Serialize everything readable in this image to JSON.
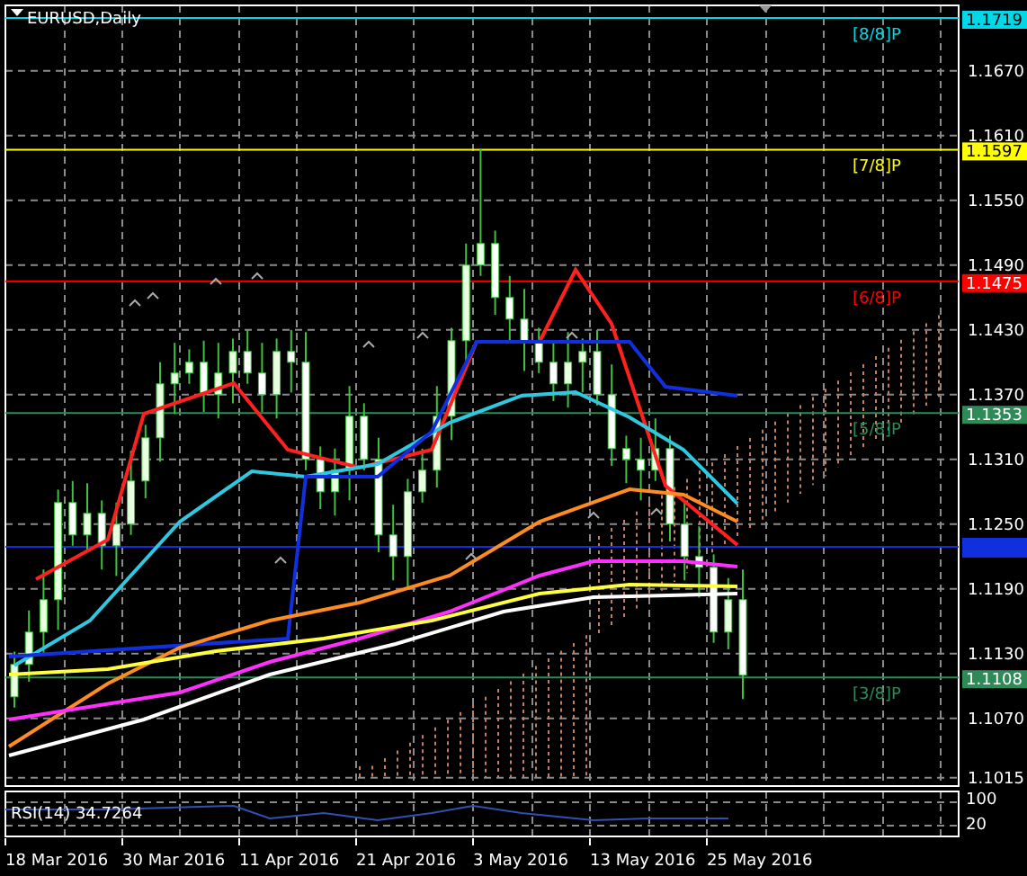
{
  "chart": {
    "title": "EURUSD,Daily",
    "price_ticks": [
      "1.1670",
      "1.1610",
      "1.1550",
      "1.1490",
      "1.1430",
      "1.1370",
      "1.1310",
      "1.1250",
      "1.1190",
      "1.1130",
      "1.1070",
      "1.1015"
    ],
    "price_lines": [
      {
        "tag": "1.1719",
        "line_label": "[8/8]P",
        "color": "#00d8e8"
      },
      {
        "tag": "1.1597",
        "line_label": "[7/8]P",
        "color": "#ffff00"
      },
      {
        "tag": "1.1475",
        "line_label": "[6/8]P",
        "color": "#ff0000"
      },
      {
        "tag": "1.1353",
        "line_label": "[5/8]P",
        "color": "#2e8b57"
      },
      {
        "tag": "1.1108",
        "line_label": "[3/8]P",
        "color": "#2e8b57"
      }
    ],
    "dates": [
      "18 Mar 2016",
      "30 Mar 2016",
      "11 Apr 2016",
      "21 Apr 2016",
      "3 May 2016",
      "13 May 2016",
      "25 May 2016"
    ],
    "rsi": {
      "label": "RSI(14) 34.7264",
      "scale": [
        "100",
        "20"
      ]
    }
  }
}
